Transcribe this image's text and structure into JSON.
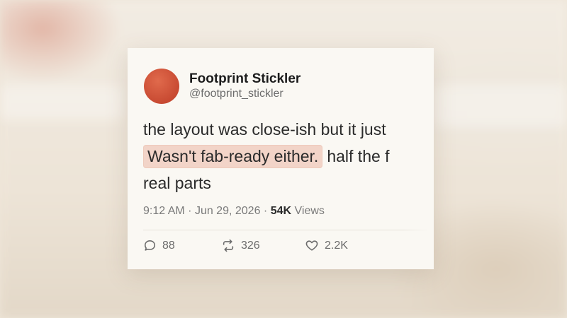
{
  "post": {
    "author": {
      "display_name": "Footprint Stickler",
      "handle": "@footprint_stickler"
    },
    "body": {
      "line1": "the layout was close-ish but it just",
      "highlight": "Wasn't fab-ready either.",
      "line2_rest": "half the f",
      "line3": "real parts"
    },
    "meta": {
      "time": "9:12 AM",
      "sep1": "·",
      "date": "Jun 29, 2026",
      "sep2": "·",
      "views_count": "54K",
      "views_label": "Views"
    },
    "actions": {
      "replies": "88",
      "reposts": "326",
      "likes": "2.2K"
    }
  },
  "icons": {
    "reply": "reply-icon",
    "repost": "repost-icon",
    "like": "heart-icon"
  },
  "colors": {
    "avatar": "#c84a32",
    "highlight": "#f2d4c8",
    "card_background": "#faf8f3"
  }
}
